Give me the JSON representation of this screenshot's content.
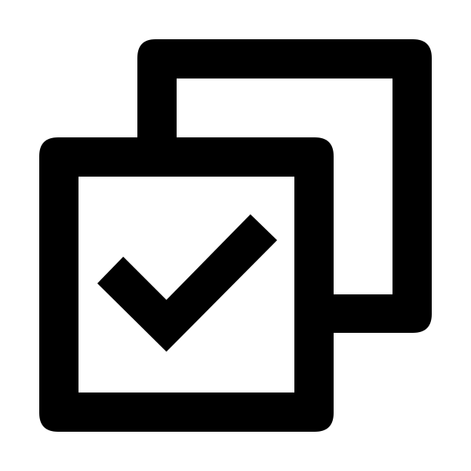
{
  "icon": {
    "name": "select-all-checkbox-icon",
    "foreground": "#000000",
    "background": "#ffffff"
  }
}
